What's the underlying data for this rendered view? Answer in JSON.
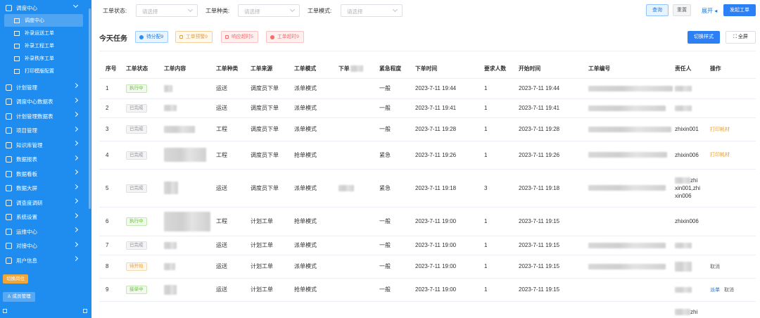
{
  "sidebar": {
    "dispatch_center": "调度中心",
    "sub_items": [
      "调度中心",
      "补录运送工单",
      "补录工程工单",
      "补录秩序工单",
      "打印模版配置"
    ],
    "groups": [
      "计划管理",
      "调度中心数据表",
      "计划管理数据表",
      "项目管理",
      "知识库管理",
      "数据报表",
      "数据看板",
      "数据大屏",
      "调查度调研",
      "系统设置",
      "运维中心",
      "对接中心",
      "用户信息"
    ],
    "switch_post": "切换岗位",
    "member_manage": "成员管理"
  },
  "filters": {
    "status_label": "工单状态:",
    "type_label": "工单种类:",
    "mode_label": "工单模式:",
    "placeholder": "请选择",
    "query": "查询",
    "reset": "重置",
    "expand": "展开",
    "new_order": "发起工单"
  },
  "today": {
    "title": "今天任务",
    "chips": [
      "待分配9",
      "工单预警9",
      "响应超时5",
      "工单超时9"
    ],
    "switch_style": "切换样式",
    "fullscreen": "全屏"
  },
  "table": {
    "headers": [
      "序号",
      "工单状态",
      "工单内容",
      "工单种类",
      "工单来源",
      "工单模式",
      "下单",
      "紧急程度",
      "下单时间",
      "要求人数",
      "开始时间",
      "工单编号",
      "责任人",
      "操作"
    ],
    "rows": [
      {
        "no": "1",
        "status": "执行中",
        "kind": "运送",
        "source": "调度员下单",
        "mode": "派单模式",
        "urgency": "一般",
        "order_time": "2023-7-11 19:44",
        "people": "1",
        "start_time": "2023-7-11 19:44",
        "owner": "",
        "op1": "",
        "op2": ""
      },
      {
        "no": "2",
        "status": "已完成",
        "kind": "运送",
        "source": "调度员下单",
        "mode": "派单模式",
        "urgency": "一般",
        "order_time": "2023-7-11 19:41",
        "people": "1",
        "start_time": "2023-7-11 19:41",
        "owner": "",
        "op1": "",
        "op2": ""
      },
      {
        "no": "3",
        "status": "已完成",
        "kind": "工程",
        "source": "调度员下单",
        "mode": "派单模式",
        "urgency": "一般",
        "order_time": "2023-7-11 19:28",
        "people": "1",
        "start_time": "2023-7-11 19:28",
        "owner": "zhixin001",
        "op1": "打印耗材",
        "op2": ""
      },
      {
        "no": "4",
        "status": "已完成",
        "kind": "工程",
        "source": "调度员下单",
        "mode": "抢单模式",
        "urgency": "紧急",
        "order_time": "2023-7-11 19:26",
        "people": "1",
        "start_time": "2023-7-11 19:26",
        "owner": "zhixin006",
        "op1": "打印耗材",
        "op2": ""
      },
      {
        "no": "5",
        "status": "已完成",
        "kind": "运送",
        "source": "调度员下单",
        "mode": "派单模式",
        "urgency": "紧急",
        "order_time": "2023-7-11 19:18",
        "people": "3",
        "start_time": "2023-7-11 19:18",
        "owner": "zhi xin001,zhi xin006",
        "op1": "",
        "op2": ""
      },
      {
        "no": "6",
        "status": "执行中",
        "kind": "工程",
        "source": "计划工单",
        "mode": "抢单模式",
        "urgency": "一般",
        "order_time": "2023-7-11 19:00",
        "people": "1",
        "start_time": "2023-7-11 19:15",
        "owner": "zhixin006",
        "op1": "",
        "op2": ""
      },
      {
        "no": "7",
        "status": "已完成",
        "kind": "运送",
        "source": "计划工单",
        "mode": "派单模式",
        "urgency": "一般",
        "order_time": "2023-7-11 19:00",
        "people": "1",
        "start_time": "2023-7-11 19:15",
        "owner": "",
        "op1": "",
        "op2": ""
      },
      {
        "no": "8",
        "status": "待开始",
        "kind": "运送",
        "source": "计划工单",
        "mode": "派单模式",
        "urgency": "一般",
        "order_time": "2023-7-11 19:00",
        "people": "1",
        "start_time": "2023-7-11 19:15",
        "owner": "",
        "op1": "取消",
        "op2": ""
      },
      {
        "no": "9",
        "status": "接单中",
        "kind": "运送",
        "source": "计划工单",
        "mode": "抢单模式",
        "urgency": "一般",
        "order_time": "2023-7-11 19:00",
        "people": "1",
        "start_time": "2023-7-11 19:15",
        "owner": "",
        "op1": "派单",
        "op2": "取消"
      },
      {
        "no": "",
        "status": "",
        "kind": "",
        "source": "",
        "mode": "",
        "urgency": "",
        "order_time": "",
        "people": "",
        "start_time": "",
        "owner": "zhi",
        "op1": "",
        "op2": ""
      }
    ]
  },
  "colors": {
    "sidebar_bg": "#1f8cf0",
    "primary": "#2c7ff5",
    "success": "#67c23a",
    "warning": "#e6a23c",
    "danger": "#f56c6c",
    "info": "#909399"
  }
}
